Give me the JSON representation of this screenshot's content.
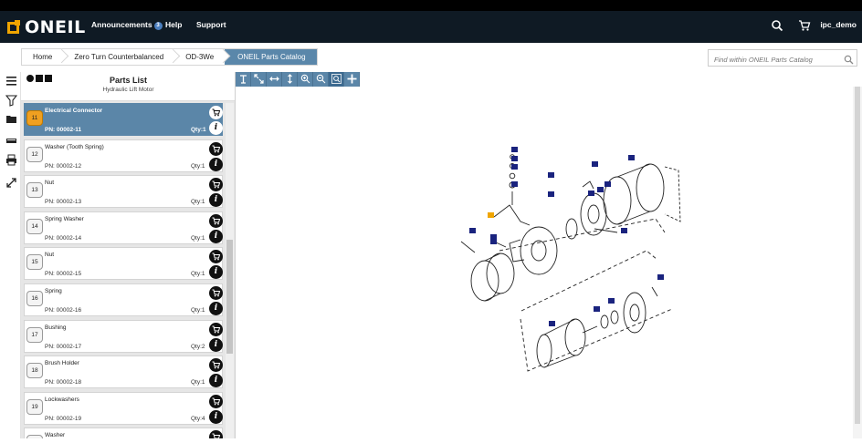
{
  "brand": {
    "name": "ONEIL",
    "accent": "#f0a500"
  },
  "nav": {
    "announcements_label": "Announcements",
    "announcements_count": "3",
    "help_label": "Help",
    "support_label": "Support",
    "user_label": "ipc_demo"
  },
  "breadcrumbs": [
    {
      "label": "Home"
    },
    {
      "label": "Zero Turn Counterbalanced"
    },
    {
      "label": "OD-3We"
    },
    {
      "label": "ONEIL Parts Catalog"
    }
  ],
  "search": {
    "placeholder": "Find within ONEIL Parts Catalog"
  },
  "parts_panel": {
    "title": "Parts List",
    "subtitle": "Hydraulic Lift Motor",
    "items": [
      {
        "num": "11",
        "name": "Electrical Connector",
        "pn": "PN: 00002-11",
        "qty": "Qty:1",
        "selected": true
      },
      {
        "num": "12",
        "name": "Washer (Tooth Spring)",
        "pn": "PN: 00002-12",
        "qty": "Qty:1"
      },
      {
        "num": "13",
        "name": "Nut",
        "pn": "PN: 00002-13",
        "qty": "Qty:1"
      },
      {
        "num": "14",
        "name": "Spring Washer",
        "pn": "PN: 00002-14",
        "qty": "Qty:1"
      },
      {
        "num": "15",
        "name": "Nut",
        "pn": "PN: 00002-15",
        "qty": "Qty:1"
      },
      {
        "num": "16",
        "name": "Spring",
        "pn": "PN: 00002-16",
        "qty": "Qty:1"
      },
      {
        "num": "17",
        "name": "Bushing",
        "pn": "PN: 00002-17",
        "qty": "Qty:2"
      },
      {
        "num": "18",
        "name": "Brush Holder",
        "pn": "PN: 00002-18",
        "qty": "Qty:1"
      },
      {
        "num": "19",
        "name": "Lockwashers",
        "pn": "PN: 00002-19",
        "qty": "Qty:4"
      },
      {
        "num": "20",
        "name": "Washer",
        "pn": "",
        "qty": ""
      }
    ]
  },
  "diagram": {
    "callouts": [
      "15",
      "14",
      "13",
      "16",
      "12",
      "17",
      "11",
      "22",
      "3",
      "19",
      "20",
      "18",
      "1",
      "3",
      "4",
      "27",
      "10",
      "26",
      "5",
      "6",
      "7",
      "8",
      "25",
      "9",
      "24",
      "23",
      "2"
    ],
    "highlight_color": "#f0a500",
    "callout_color": "#1a237e"
  }
}
